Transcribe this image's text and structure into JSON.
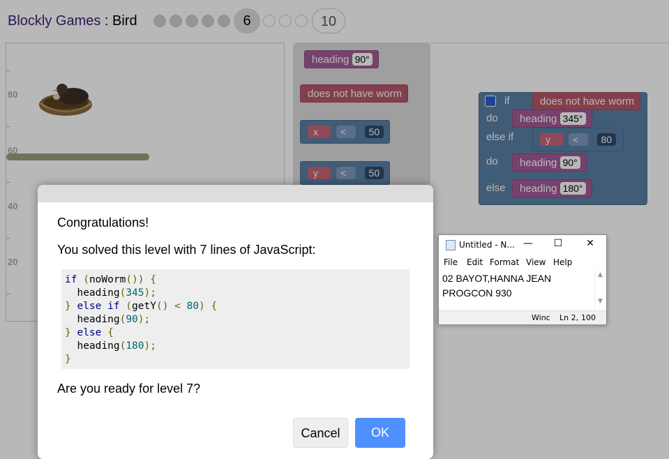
{
  "header": {
    "brand": "Blockly Games",
    "separator": " : ",
    "game": "Bird",
    "current_level": "6",
    "last_level": "10"
  },
  "game_area": {
    "y_ticks": [
      "80",
      "60",
      "40",
      "20"
    ]
  },
  "toolbox": {
    "heading_label": "heading",
    "heading_value": "90°",
    "no_worm_label": "does not have worm",
    "compare_x": {
      "var": "x",
      "op": "<",
      "value": "50"
    },
    "compare_y": {
      "var": "y",
      "op": "<",
      "value": "50"
    }
  },
  "program": {
    "if_label": "if",
    "condition": "does not have worm",
    "do_label": "do",
    "heading_label": "heading",
    "heading_1": "345°",
    "else_if_label": "else if",
    "compare": {
      "var": "y",
      "op": "<",
      "value": "80"
    },
    "heading_2": "90°",
    "else_label": "else",
    "heading_3": "180°"
  },
  "dialog": {
    "congrats": "Congratulations!",
    "solved": "You solved this level with 7 lines of JavaScript:",
    "code": {
      "l1_kw": "if",
      "l1_fn": "noWorm",
      "l2_fn": "heading",
      "l2_num": "345",
      "l3_kw": "else if",
      "l3_fn": "getY",
      "l3_num": "80",
      "l4_fn": "heading",
      "l4_num": "90",
      "l5_kw": "else",
      "l6_fn": "heading",
      "l6_num": "180"
    },
    "question": "Are you ready for level 7?",
    "cancel_label": "Cancel",
    "ok_label": "OK",
    "ok_color": "#4d90fe"
  },
  "notepad": {
    "title": "Untitled - N...",
    "menu": [
      "File",
      "Edit",
      "Format",
      "View",
      "Help"
    ],
    "line1": "02 BAYOT,HANNA JEAN",
    "line2": "PROGCON 930",
    "status_win": "Winc",
    "status_pos": "Ln 2,",
    "status_zoom": "100"
  }
}
